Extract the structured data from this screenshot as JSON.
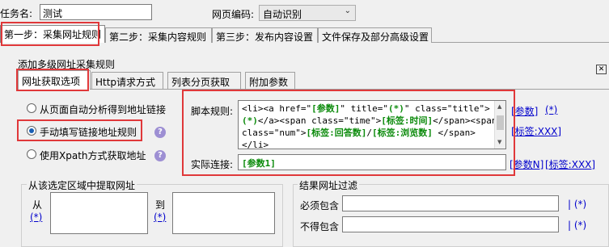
{
  "task": {
    "name_label": "任务名:",
    "name_value": "测试",
    "encoding_label": "网页编码:",
    "encoding_value": "自动识别"
  },
  "main_tabs": [
    {
      "label": "第一步：采集网址规则"
    },
    {
      "label": "第二步：采集内容规则"
    },
    {
      "label": "第三步：发布内容设置"
    },
    {
      "label": "文件保存及部分高级设置"
    }
  ],
  "section_title": "添加多级网址采集规则",
  "sub_tabs": [
    {
      "label": "网址获取选项"
    },
    {
      "label": "Http请求方式"
    },
    {
      "label": "列表分页获取"
    },
    {
      "label": "附加参数"
    }
  ],
  "options": [
    {
      "label": "从页面自动分析得到地址链接",
      "selected": false
    },
    {
      "label": "手动填写链接地址规则",
      "selected": true
    },
    {
      "label": "使用Xpath方式获取地址",
      "selected": false
    }
  ],
  "script": {
    "label": "脚本规则:",
    "lines": [
      "<li><a href=\"[参数]\" title=\"(*)\" class=\"title\">",
      "(*)</a><span class=\"time\">[标签:时间]</span><span",
      "class=\"num\">[标签:回答数]/[标签:浏览数] </span>",
      "</li>"
    ],
    "links": {
      "param": "[参数]",
      "wildcard": "(*)",
      "tag": "[标签:XXX]"
    }
  },
  "actual": {
    "label": "实际连接:",
    "value": "[参数1]",
    "links": {
      "param_n": "[参数N]",
      "tag": "[标签:XXX]"
    }
  },
  "extract_region": {
    "title": "从该选定区域中提取网址",
    "from_label": "从",
    "to_label": "到",
    "wildcard": "(*)"
  },
  "filter": {
    "title": "结果网址过滤",
    "must_contain_label": "必须包含",
    "must_not_contain_label": "不得包含",
    "link": "| (*)"
  },
  "colors": {
    "highlight": "#e0383a",
    "link": "#0000cc",
    "green": "#0a8a0a"
  }
}
